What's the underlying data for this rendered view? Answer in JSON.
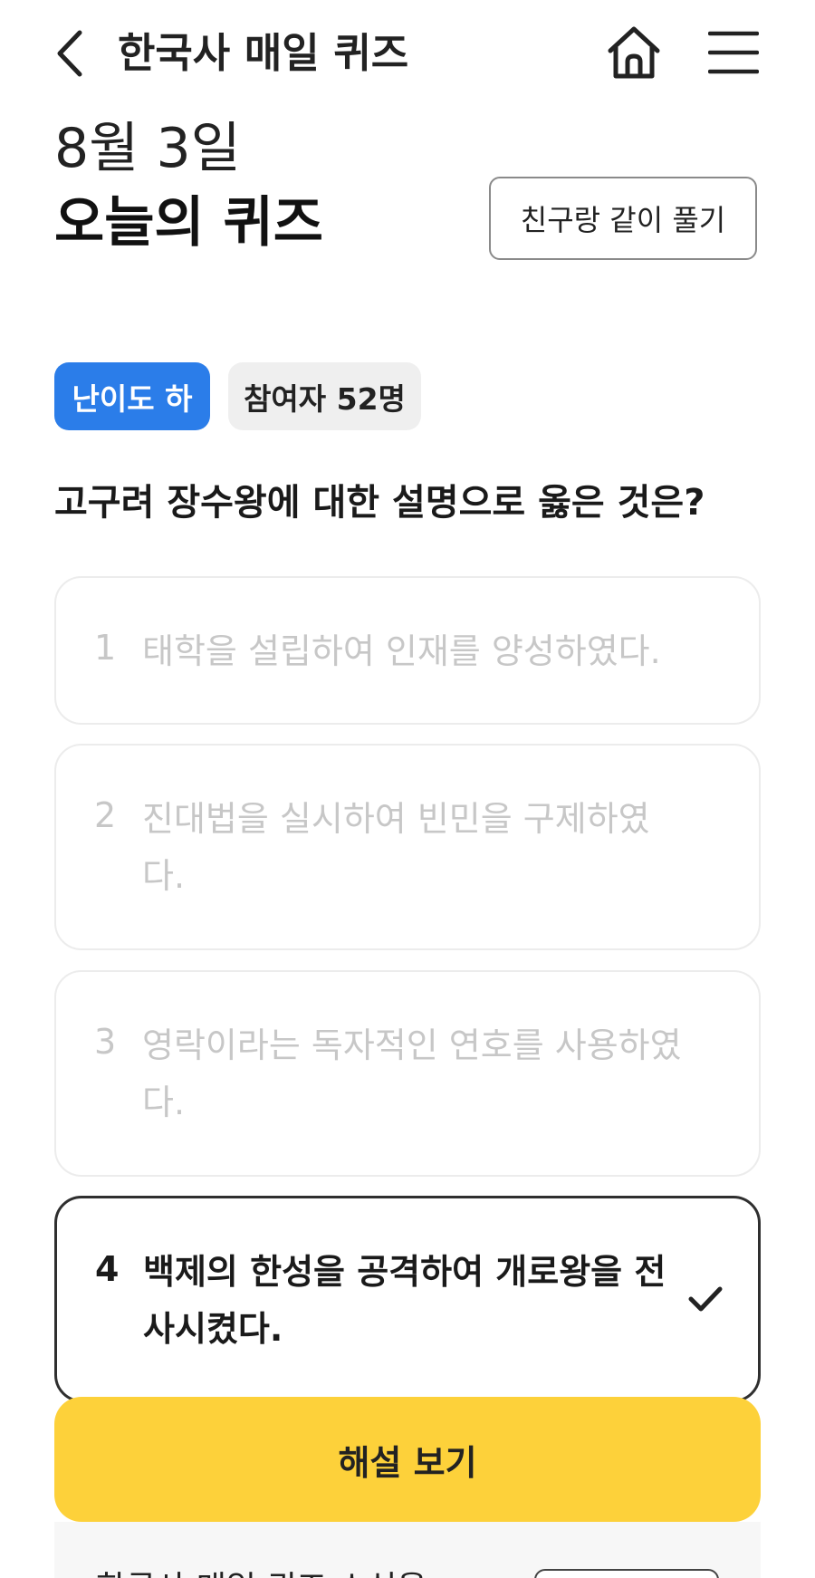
{
  "header": {
    "title": "한국사 매일 퀴즈"
  },
  "quiz": {
    "date": "8월 3일",
    "title": "오늘의 퀴즈",
    "friend_button": "친구랑 같이 풀기",
    "difficulty": "난이도 하",
    "participants": "참여자 52명",
    "question": "고구려 장수왕에 대한 설명으로 옳은 것은?",
    "options": [
      {
        "num": "1",
        "text": "태학을 설립하여 인재를 양성하였다."
      },
      {
        "num": "2",
        "text": "진대법을 실시하여 빈민을 구제하였다."
      },
      {
        "num": "3",
        "text": "영락이라는 독자적인 연호를 사용하였다."
      },
      {
        "num": "4",
        "text": "백제의 한성을 공격하여 개로왕을 전사시켰다."
      }
    ],
    "selected_option": "4",
    "explain_button": "해설 보기"
  },
  "bottom": {
    "text": "한국사 매일 퀴즈 소식을"
  },
  "colors": {
    "accent_blue": "#2b7de9",
    "button_yellow": "#fdd13a"
  },
  "icons": {
    "back": "chevron-left-icon",
    "home": "home-icon",
    "menu": "hamburger-menu-icon",
    "selected": "check-icon"
  }
}
